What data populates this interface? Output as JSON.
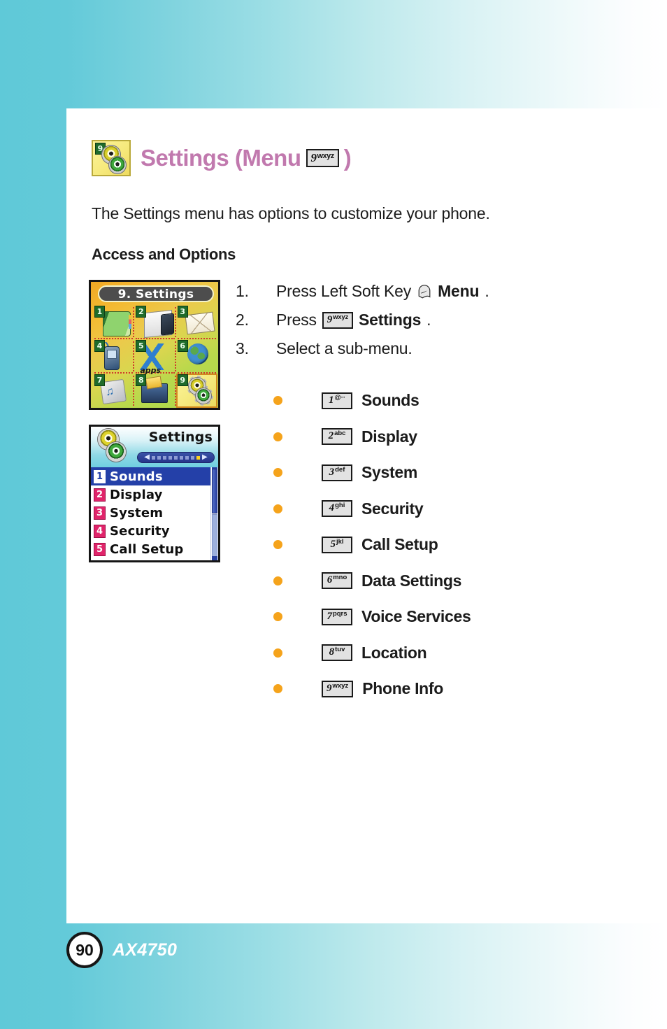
{
  "title": {
    "icon_name": "settings-gears-icon",
    "badge": "9",
    "text_before": "Settings (Menu",
    "key": {
      "digit": "9",
      "letters": "wxyz"
    },
    "text_after": ")",
    "color": "#c179ae"
  },
  "intro": "The Settings menu has options to customize your phone.",
  "subheading": "Access and Options",
  "screens": {
    "grid": {
      "title": "9. Settings",
      "cells": [
        {
          "num": "1",
          "art": "art-book",
          "label": ""
        },
        {
          "num": "2",
          "art": "art-paper",
          "label": ""
        },
        {
          "num": "3",
          "art": "art-env",
          "label": ""
        },
        {
          "num": "4",
          "art": "art-phone",
          "label": ""
        },
        {
          "num": "5",
          "art": "art-apps",
          "label": "apps"
        },
        {
          "num": "6",
          "art": "art-globe",
          "label": ""
        },
        {
          "num": "7",
          "art": "art-disc",
          "label": ""
        },
        {
          "num": "8",
          "art": "art-case",
          "label": ""
        },
        {
          "num": "9",
          "art": "art-gears",
          "label": ""
        }
      ],
      "selected_index": 9
    },
    "list": {
      "header_title": "Settings",
      "pager_dots": 9,
      "pager_active_dot": 9,
      "rows": [
        {
          "num": "1",
          "label": "Sounds",
          "selected": true
        },
        {
          "num": "2",
          "label": "Display",
          "selected": false
        },
        {
          "num": "3",
          "label": "System",
          "selected": false
        },
        {
          "num": "4",
          "label": "Security",
          "selected": false
        },
        {
          "num": "5",
          "label": "Call Setup",
          "selected": false
        }
      ]
    }
  },
  "steps": [
    {
      "number": "1.",
      "pre": "Press Left Soft Key",
      "icon": "left-soft-key-icon",
      "bold": "Menu",
      "post": "."
    },
    {
      "number": "2.",
      "pre": "Press",
      "key": {
        "digit": "9",
        "letters": "wxyz"
      },
      "bold": "Settings",
      "post": "."
    },
    {
      "number": "3.",
      "pre": "Select a sub-menu.",
      "bold": "",
      "post": ""
    }
  ],
  "submenus": [
    {
      "key": {
        "digit": "1",
        "letters": "@··"
      },
      "label": "Sounds"
    },
    {
      "key": {
        "digit": "2",
        "letters": "abc"
      },
      "label": "Display"
    },
    {
      "key": {
        "digit": "3",
        "letters": "def"
      },
      "label": "System"
    },
    {
      "key": {
        "digit": "4",
        "letters": "ghi"
      },
      "label": "Security"
    },
    {
      "key": {
        "digit": "5",
        "letters": "jkl"
      },
      "label": "Call Setup"
    },
    {
      "key": {
        "digit": "6",
        "letters": "mno"
      },
      "label": "Data Settings"
    },
    {
      "key": {
        "digit": "7",
        "letters": "pqrs"
      },
      "label": "Voice Services"
    },
    {
      "key": {
        "digit": "8",
        "letters": "tuv"
      },
      "label": "Location"
    },
    {
      "key": {
        "digit": "9",
        "letters": "wxyz"
      },
      "label": "Phone Info"
    }
  ],
  "footer": {
    "page_number": "90",
    "model": "AX4750"
  },
  "colors": {
    "accent_cyan": "#5fc9d8",
    "title_mauve": "#c179ae",
    "bullet_orange": "#f5a31b",
    "list_selected_blue": "#2440a8",
    "list_badge_pink": "#e0246a"
  }
}
